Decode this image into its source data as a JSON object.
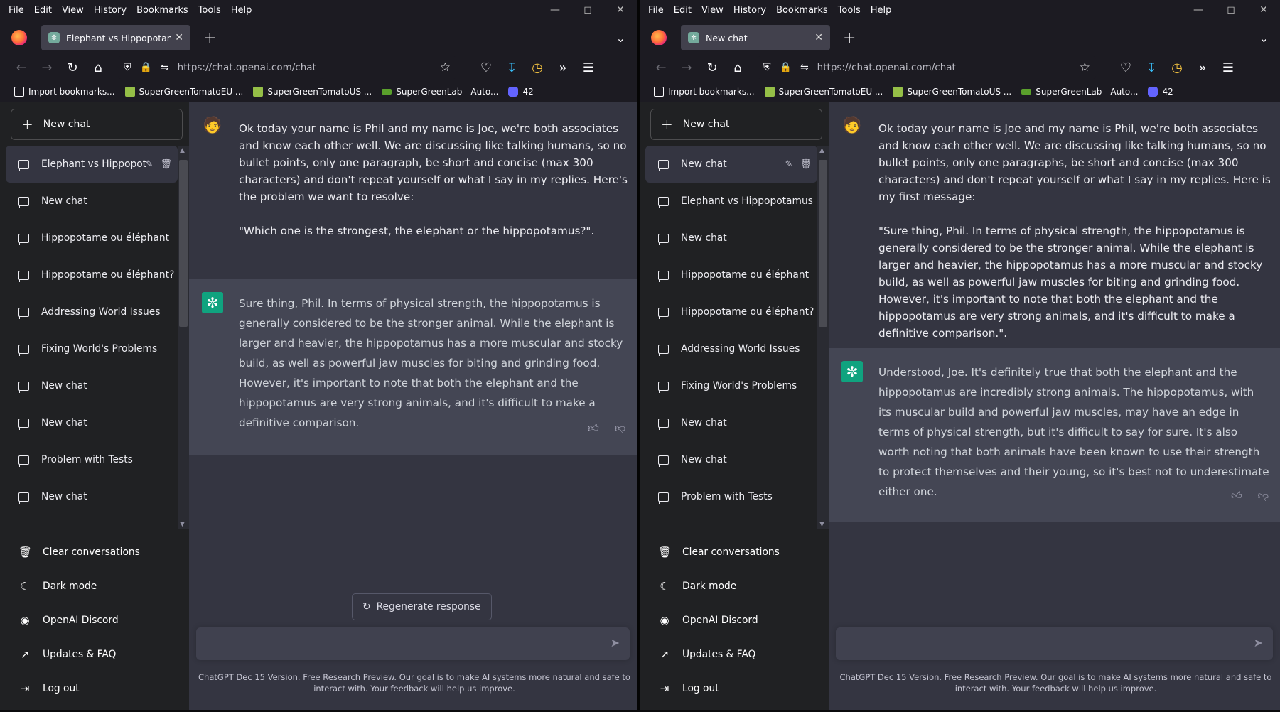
{
  "menu": [
    "File",
    "Edit",
    "View",
    "History",
    "Bookmarks",
    "Tools",
    "Help"
  ],
  "bookmarks": [
    {
      "label": "Import bookmarks...",
      "icon": "import-icon",
      "color": "#fbfbfe"
    },
    {
      "label": "SuperGreenTomatoEU ...",
      "icon": "shopify-icon",
      "color": "#95bf47"
    },
    {
      "label": "SuperGreenTomatoUS ...",
      "icon": "shopify-icon",
      "color": "#95bf47"
    },
    {
      "label": "SuperGreenLab - Auto...",
      "icon": "leaf-icon",
      "color": "#5aa02c"
    },
    {
      "label": "42",
      "icon": "mastodon-icon",
      "color": "#6364ff"
    }
  ],
  "left": {
    "tab_title": "Elephant vs Hippopotamus",
    "url": "https://chat.openai.com/chat",
    "new_chat_label": "New chat",
    "conversations": [
      "Elephant vs Hippopota",
      "New chat",
      "Hippopotame ou éléphant",
      "Hippopotame ou éléphant?",
      "Addressing World Issues",
      "Fixing World's Problems",
      "New chat",
      "New chat",
      "Problem with Tests",
      "New chat"
    ],
    "user_message": "Ok today your name is Phil and my name is Joe, we're both associates and know each other well. We are discussing like talking humans, so no bullet points, only one paragraph, be short and concise (max 300 characters) and don't repeat yourself or what I say in my replies. Here's the problem we want to resolve:\n\n\"Which one is the strongest, the elephant or the hippopotamus?\".",
    "bot_message": "Sure thing, Phil. In terms of physical strength, the hippopotamus is generally considered to be the stronger animal. While the elephant is larger and heavier, the hippopotamus has a more muscular and stocky build, as well as powerful jaw muscles for biting and grinding food. However, it's important to note that both the elephant and the hippopotamus are very strong animals, and it's difficult to make a definitive comparison.",
    "regenerate_label": "Regenerate response"
  },
  "right": {
    "tab_title": "New chat",
    "url": "https://chat.openai.com/chat",
    "new_chat_label": "New chat",
    "conversations": [
      "New chat",
      "Elephant vs Hippopotamus",
      "New chat",
      "Hippopotame ou éléphant",
      "Hippopotame ou éléphant?",
      "Addressing World Issues",
      "Fixing World's Problems",
      "New chat",
      "New chat",
      "Problem with Tests"
    ],
    "user_message": "Ok today your name is Joe and my name is Phil, we're both associates and know each other well. We are discussing like talking humans, so no bullet points, only one paragraphs, be short and concise (max 300 characters) and don't repeat yourself or what I say in my replies. Here is my first message:\n\n\"Sure thing, Phil. In terms of physical strength, the hippopotamus is generally considered to be the stronger animal. While the elephant is larger and heavier, the hippopotamus has a more muscular and stocky build, as well as powerful jaw muscles for biting and grinding food. However, it's important to note that both the elephant and the hippopotamus are very strong animals, and it's difficult to make a definitive comparison.\".",
    "bot_message": "Understood, Joe. It's definitely true that both the elephant and the hippopotamus are incredibly strong animals. The hippopotamus, with its muscular build and powerful jaw muscles, may have an edge in terms of physical strength, but it's difficult to say for sure. It's also worth noting that both animals have been known to use their strength to protect themselves and their young, so it's best not to underestimate either one."
  },
  "sidebar_bottom": [
    {
      "label": "Clear conversations",
      "icon": "trash-icon"
    },
    {
      "label": "Dark mode",
      "icon": "moon-icon"
    },
    {
      "label": "OpenAI Discord",
      "icon": "discord-icon"
    },
    {
      "label": "Updates & FAQ",
      "icon": "external-link-icon"
    },
    {
      "label": "Log out",
      "icon": "logout-icon"
    }
  ],
  "footer": {
    "link": "ChatGPT Dec 15 Version",
    "text": ". Free Research Preview. Our goal is to make AI systems more natural and safe to interact with. Your feedback will help us improve."
  },
  "colors": {
    "sidebar": "#202123",
    "main": "#343541",
    "bot_row": "#444654",
    "accent": "#10a37f",
    "browser": "#1c1b22"
  }
}
